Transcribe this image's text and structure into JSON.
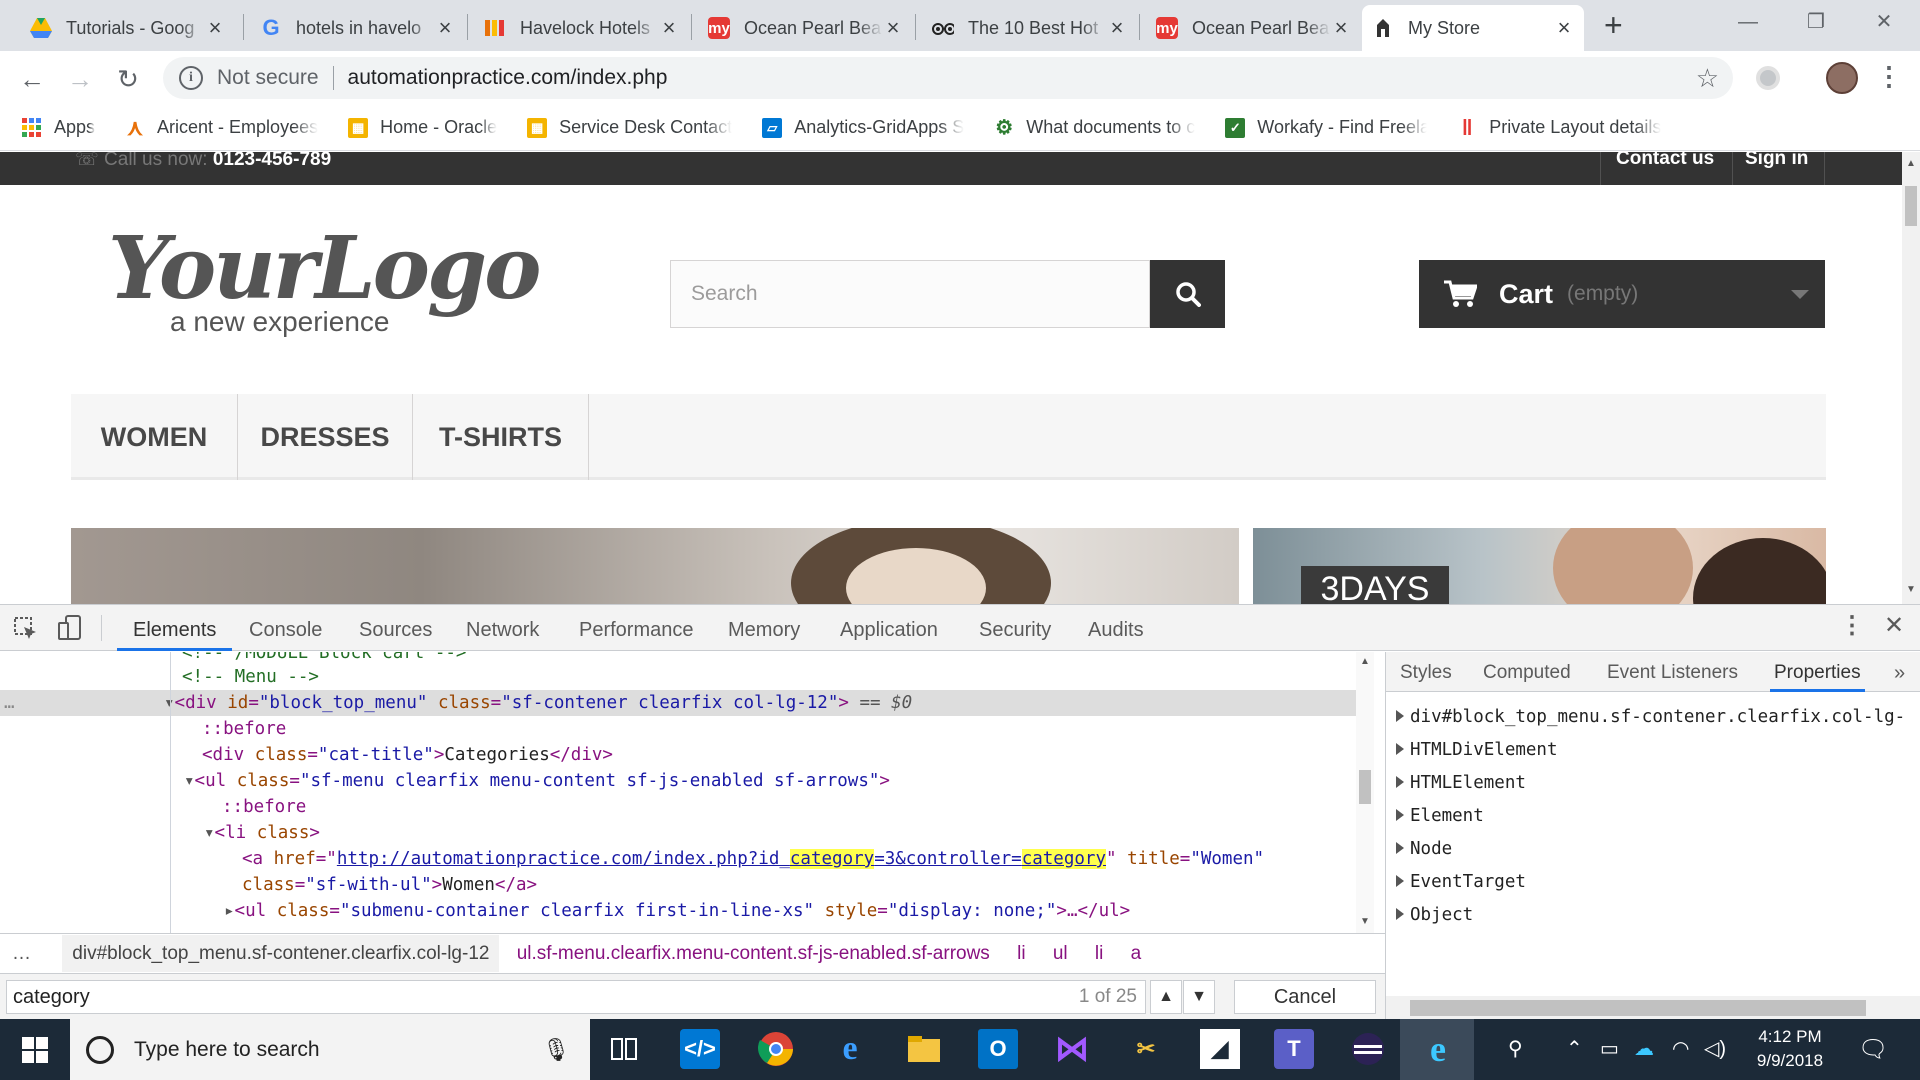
{
  "browser": {
    "tabs": [
      {
        "title": "Tutorials - Goog",
        "icon": "drive-icon",
        "color": "#fbbc04"
      },
      {
        "title": "hotels in havelo",
        "icon": "google-icon",
        "color": "#4285f4"
      },
      {
        "title": "Havelock Hotels",
        "icon": "bars-icon",
        "color": "#e8710a"
      },
      {
        "title": "Ocean Pearl Bea",
        "icon": "mmt-icon",
        "color": "#e53935"
      },
      {
        "title": "The 10 Best Hot",
        "icon": "tripadvisor-icon",
        "color": "#222222"
      },
      {
        "title": "Ocean Pearl Bea",
        "icon": "mmt-icon",
        "color": "#e53935"
      },
      {
        "title": "My Store",
        "icon": "store-icon",
        "color": "#333333"
      }
    ],
    "active_tab_index": 6,
    "omnibox": {
      "security": "Not secure",
      "url": "automationpractice.com/index.php"
    },
    "bookmarks": [
      {
        "label": "Apps",
        "icon": "apps-icon",
        "color": "#4285f4"
      },
      {
        "label": "Aricent - Employees",
        "icon": "aricent-icon",
        "color": "#e8710a"
      },
      {
        "label": "Home - Oracle",
        "icon": "oracle-icon",
        "color": "#f4b400"
      },
      {
        "label": "Service Desk Contact",
        "icon": "oracle-icon",
        "color": "#f4b400"
      },
      {
        "label": "Analytics-GridApps S",
        "icon": "azure-icon",
        "color": "#0078d4"
      },
      {
        "label": "What documents to c",
        "icon": "gear-icon",
        "color": "#2e7d32"
      },
      {
        "label": "Workafy - Find Freela",
        "icon": "check-icon",
        "color": "#2e7d32"
      },
      {
        "label": "Private Layout details",
        "icon": "red-bars-icon",
        "color": "#e53935"
      }
    ]
  },
  "page": {
    "topbar": {
      "call_label": "Call us now:",
      "phone": "0123-456-789",
      "contact": "Contact us",
      "signin": "Sign in"
    },
    "logo": {
      "main": "YourLogo",
      "tagline": "a new experience"
    },
    "search_placeholder": "Search",
    "cart": {
      "label": "Cart",
      "status": "(empty)"
    },
    "menu": [
      "WOMEN",
      "DRESSES",
      "T-SHIRTS"
    ],
    "banner_text": "3DAYS"
  },
  "devtools": {
    "tabs": [
      "Elements",
      "Console",
      "Sources",
      "Network",
      "Performance",
      "Memory",
      "Application",
      "Security",
      "Audits"
    ],
    "active_tab": "Elements",
    "dom": {
      "l0": "<!-- /MODULE Block cart -->",
      "l1": "<!-- Menu -->",
      "l2_tag": "<div ",
      "l2_id_attr": "id",
      "l2_id_val": "\"block_top_menu\"",
      "l2_class_attr": "class",
      "l2_class_val": "\"sf-contener clearfix col-lg-12\"",
      "l2_end": ">",
      "l2_eq": " == $0",
      "l3": "::before",
      "l4_open": "<div ",
      "l4_attr": "class",
      "l4_val": "\"cat-title\"",
      "l4_text": "Categories",
      "l4_close": "</div>",
      "l5_open": "<ul ",
      "l5_attr": "class",
      "l5_val": "\"sf-menu clearfix menu-content sf-js-enabled sf-arrows\"",
      "l6": "::before",
      "l7_open": "<li ",
      "l7_attr": "class",
      "l8_open": "<a ",
      "l8_href_attr": "href",
      "l8_url_a": "http://automationpractice.com/index.php?id_",
      "l8_hl1": "category",
      "l8_url_b": "=3&controller=",
      "l8_hl2": "category",
      "l8_title_attr": "title",
      "l8_title_val": "\"Women\"",
      "l9_attr": "class",
      "l9_val": "\"sf-with-ul\"",
      "l9_text": "Women",
      "l9_close": "</a>",
      "l10_open": "<ul ",
      "l10_attr": "class",
      "l10_val": "\"submenu-container clearfix first-in-line-xs\"",
      "l10_style_attr": "style",
      "l10_style_val": "\"display: none;\"",
      "l10_close": ">…</ul>"
    },
    "breadcrumbs": [
      "div#block_top_menu.sf-contener.clearfix.col-lg-12",
      "ul.sf-menu.clearfix.menu-content.sf-js-enabled.sf-arrows",
      "li",
      "ul",
      "li",
      "a"
    ],
    "find": {
      "query": "category",
      "count": "1 of 25",
      "cancel": "Cancel"
    },
    "side_tabs": [
      "Styles",
      "Computed",
      "Event Listeners",
      "Properties"
    ],
    "active_side_tab": "Properties",
    "properties": [
      "div#block_top_menu.sf-contener.clearfix.col-lg-",
      "HTMLDivElement",
      "HTMLElement",
      "Element",
      "Node",
      "EventTarget",
      "Object"
    ]
  },
  "taskbar": {
    "search_placeholder": "Type here to search",
    "time": "4:12 PM",
    "date": "9/9/2018"
  }
}
